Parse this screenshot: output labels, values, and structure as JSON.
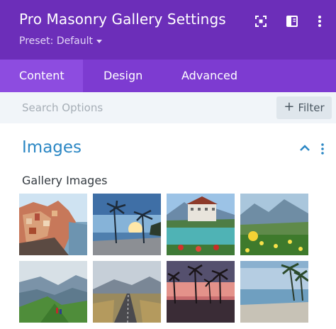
{
  "header": {
    "title": "Pro Masonry Gallery Settings",
    "preset": "Preset: Default",
    "icons": [
      "fullscreen-icon",
      "sidebar-layout-icon",
      "more-options-icon"
    ],
    "background_color": "#6c2eb9"
  },
  "tabs": [
    {
      "label": "Content",
      "active": true
    },
    {
      "label": "Design",
      "active": false
    },
    {
      "label": "Advanced",
      "active": false
    }
  ],
  "search": {
    "placeholder": "Search Options",
    "filter_label": "Filter"
  },
  "section": {
    "title": "Images",
    "title_color": "#2b87c4"
  },
  "gallery": {
    "label": "Gallery Images",
    "images": [
      "coastal-village",
      "palm-beach-sunset",
      "lakeside-resort",
      "mountain-meadow",
      "mountain-ridge-hikers",
      "mountain-road",
      "palm-sunset-silhouette",
      "tropical-beach"
    ]
  }
}
